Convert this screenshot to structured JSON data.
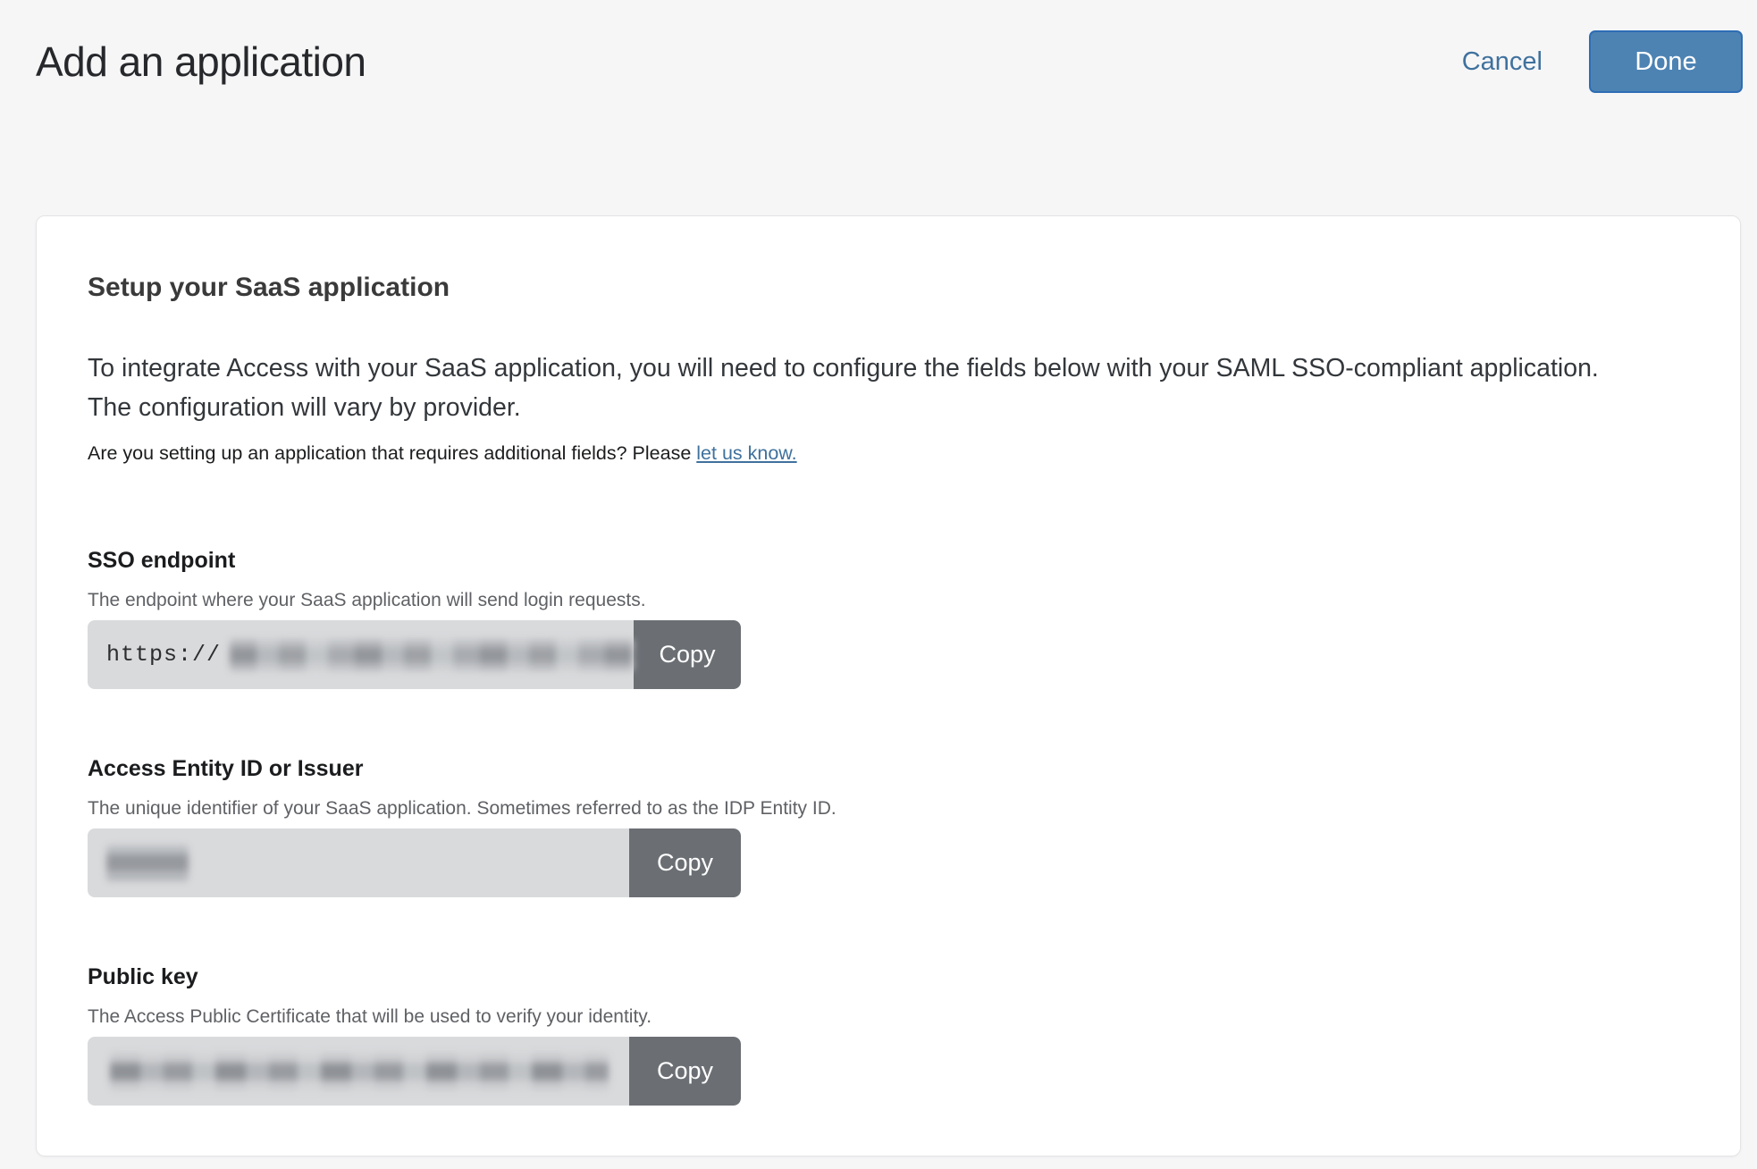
{
  "header": {
    "title": "Add an application",
    "cancel_label": "Cancel",
    "done_label": "Done"
  },
  "card": {
    "title": "Setup your SaaS application",
    "intro": "To integrate Access with your SaaS application, you will need to configure the fields below with your SAML SSO-compliant application. The configuration will vary by provider.",
    "note_text": "Are you setting up an application that requires additional fields? Please ",
    "note_link": "let us know.",
    "copy_label": "Copy",
    "fields": [
      {
        "label": "SSO endpoint",
        "description": "The endpoint where your SaaS application will send login requests.",
        "value_prefix": "https://"
      },
      {
        "label": "Access Entity ID or Issuer",
        "description": "The unique identifier of your SaaS application. Sometimes referred to as the IDP Entity ID.",
        "value_prefix": ""
      },
      {
        "label": "Public key",
        "description": "The Access Public Certificate that will be used to verify your identity.",
        "value_prefix": ""
      }
    ]
  },
  "colors": {
    "accent_blue": "#4d83b3",
    "accent_blue_border": "#2d6db4",
    "link_blue": "#3f719d",
    "copy_button_gray": "#6b6f74",
    "field_gray": "#d9dadc"
  }
}
